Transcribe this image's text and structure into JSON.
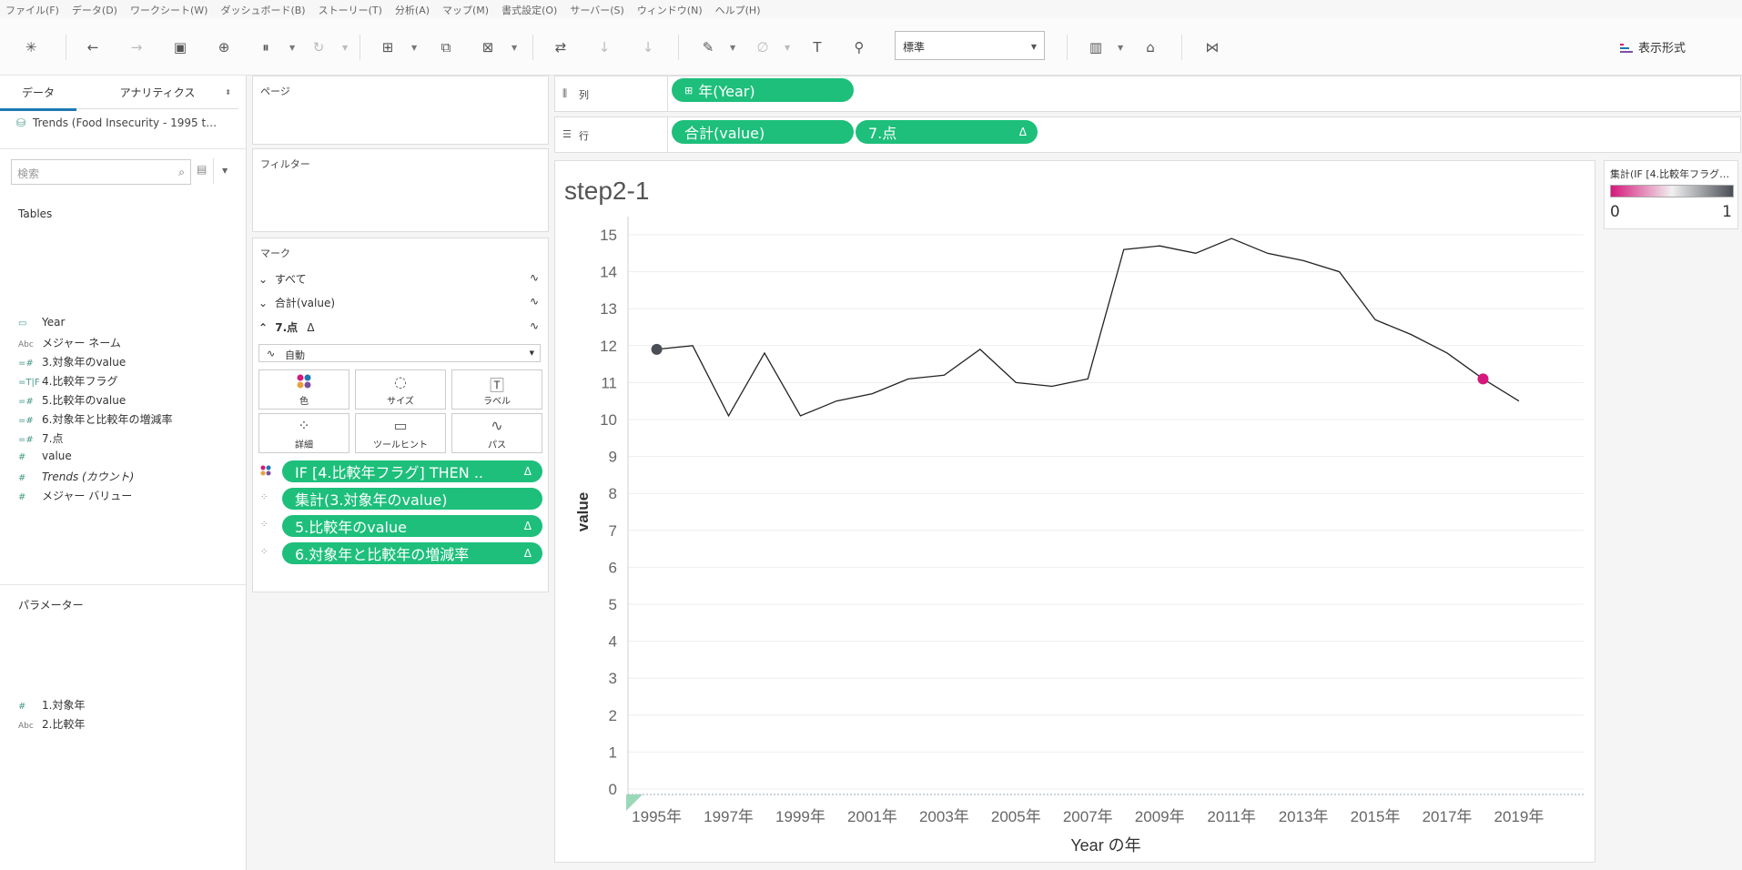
{
  "menu": [
    "ファイル(F)",
    "データ(D)",
    "ワークシート(W)",
    "ダッシュボード(B)",
    "ストーリー(T)",
    "分析(A)",
    "マップ(M)",
    "書式設定(O)",
    "サーバー(S)",
    "ウィンドウ(N)",
    "ヘルプ(H)"
  ],
  "toolbar": {
    "fit_value": "標準",
    "show_me_label": "表示形式"
  },
  "data_pane": {
    "tab_data": "データ",
    "tab_analytics": "アナリティクス",
    "datasource": "Trends (Food Insecurity - 1995 t…",
    "search_placeholder": "検索",
    "tables_header": "Tables",
    "fields": [
      {
        "icon": "calendar-icon",
        "glyph": "▭",
        "label": "Year"
      },
      {
        "icon": "abc-icon",
        "glyph": "Abc",
        "label": "メジャー ネーム"
      },
      {
        "icon": "calc-measure-icon",
        "glyph": "=#",
        "label": "3.対象年のvalue"
      },
      {
        "icon": "calc-boolean-icon",
        "glyph": "=T|F",
        "label": "4.比較年フラグ"
      },
      {
        "icon": "calc-measure-icon",
        "glyph": "=#",
        "label": "5.比較年のvalue"
      },
      {
        "icon": "calc-measure-icon",
        "glyph": "=#",
        "label": "6.対象年と比較年の増減率"
      },
      {
        "icon": "calc-measure-icon",
        "glyph": "=#",
        "label": "7.点"
      },
      {
        "icon": "measure-icon",
        "glyph": "#",
        "label": "value"
      },
      {
        "icon": "measure-icon",
        "glyph": "#",
        "label": "Trends (カウント)"
      },
      {
        "icon": "measure-icon",
        "glyph": "#",
        "label": "メジャー バリュー"
      }
    ],
    "parameters_header": "パラメーター",
    "parameters": [
      {
        "icon": "param-number-icon",
        "glyph": "#",
        "label": "1.対象年"
      },
      {
        "icon": "param-string-icon",
        "glyph": "Abc",
        "label": "2.比較年"
      }
    ]
  },
  "cards": {
    "pages": "ページ",
    "filters": "フィルター",
    "marks": "マーク",
    "marks_all": "すべて",
    "marks_sum": "合計(value)",
    "marks_point": "7.点",
    "mark_type": "自動",
    "mark_buttons": [
      "色",
      "サイズ",
      "ラベル",
      "詳細",
      "ツールヒント",
      "パス"
    ],
    "mark_pills": [
      {
        "label": "IF [4.比較年フラグ] THEN ..",
        "delta": "Δ",
        "icon": "color-icon"
      },
      {
        "label": "集計(3.対象年のvalue)",
        "delta": "",
        "icon": "detail-icon"
      },
      {
        "label": "5.比較年のvalue",
        "delta": "Δ",
        "icon": "detail-icon"
      },
      {
        "label": "6.対象年と比較年の増減率",
        "delta": "Δ",
        "icon": "detail-icon"
      }
    ]
  },
  "shelves": {
    "columns_label": "列",
    "rows_label": "行",
    "columns_pill": "年(Year)",
    "rows_pill_1": "合計(value)",
    "rows_pill_2": "7.点",
    "delta": "Δ"
  },
  "legend": {
    "title": "集計(IF [4.比較年フラグ…",
    "min_label": "0",
    "max_label": "1",
    "color_low": "#d6187c",
    "color_mid": "#f0f0f0",
    "color_high": "#4a4f55"
  },
  "chart_data": {
    "type": "line",
    "title": "step2-1",
    "xlabel": "Year の年",
    "ylabel": "value",
    "ylim": [
      0,
      15
    ],
    "yticks": [
      "0",
      "1",
      "2",
      "3",
      "4",
      "5",
      "6",
      "7",
      "8",
      "9",
      "10",
      "11",
      "12",
      "13",
      "14",
      "15"
    ],
    "xticks": [
      "1995年",
      "1997年",
      "1999年",
      "2001年",
      "2003年",
      "2005年",
      "2007年",
      "2009年",
      "2011年",
      "2013年",
      "2015年",
      "2017年",
      "2019年"
    ],
    "xlim": [
      1994.2,
      2020.8
    ],
    "x": [
      1995,
      1996,
      1997,
      1998,
      1999,
      2000,
      2001,
      2002,
      2003,
      2004,
      2005,
      2006,
      2007,
      2008,
      2009,
      2010,
      2011,
      2012,
      2013,
      2014,
      2015,
      2016,
      2017,
      2018,
      2019
    ],
    "values": [
      11.9,
      12.0,
      10.1,
      11.8,
      10.1,
      10.5,
      10.7,
      11.1,
      11.2,
      11.9,
      11.0,
      10.9,
      11.1,
      14.6,
      14.7,
      14.5,
      14.9,
      14.5,
      14.3,
      14.0,
      12.7,
      12.3,
      11.8,
      11.1,
      10.5
    ],
    "line_color": "#222222",
    "points": [
      {
        "x": 1995,
        "y": 11.9,
        "color": "#4a4f55",
        "flag": 1
      },
      {
        "x": 2018,
        "y": 11.1,
        "color": "#d6187c",
        "flag": 0
      }
    ]
  }
}
